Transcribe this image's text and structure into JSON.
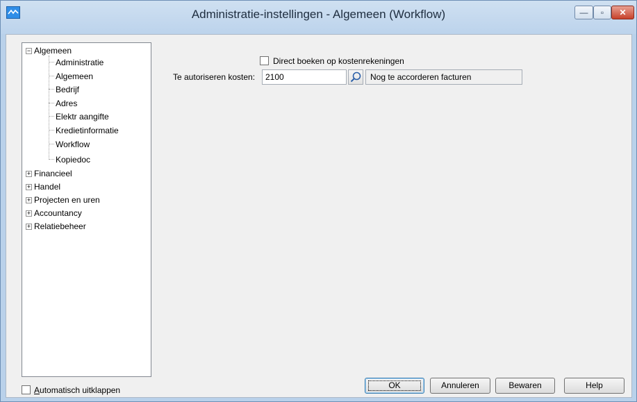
{
  "window": {
    "title": "Administratie-instellingen - Algemeen (Workflow)",
    "minimize_glyph": "—",
    "maximize_glyph": "▫",
    "close_glyph": "✕"
  },
  "tree": {
    "root_expanded_label": "Algemeen",
    "children": [
      "Administratie",
      "Algemeen",
      "Bedrijf",
      "Adres",
      "Elektr aangifte",
      "Kredietinformatie",
      "Workflow",
      "Kopiedoc"
    ],
    "collapsed_roots": [
      "Financieel",
      "Handel",
      "Projecten en uren",
      "Accountancy",
      "Relatiebeheer"
    ],
    "selected": "Workflow"
  },
  "form": {
    "direct_booking_label": "Direct boeken op kostenrekeningen",
    "direct_booking_checked": false,
    "authorize_label": "Te autoriseren kosten:",
    "authorize_value": "2100",
    "authorize_description": "Nog te accorderen facturen"
  },
  "footer": {
    "auto_expand_label_first": "A",
    "auto_expand_label_rest": "utomatisch uitklappen",
    "auto_expand_checked": false,
    "ok_label": "OK",
    "cancel_label": "Annuleren",
    "save_label": "Bewaren",
    "help_label": "Help"
  },
  "colors": {
    "titlebar": "#bcd3ec",
    "close_button": "#c7412a",
    "panel": "#f0f0f0"
  }
}
